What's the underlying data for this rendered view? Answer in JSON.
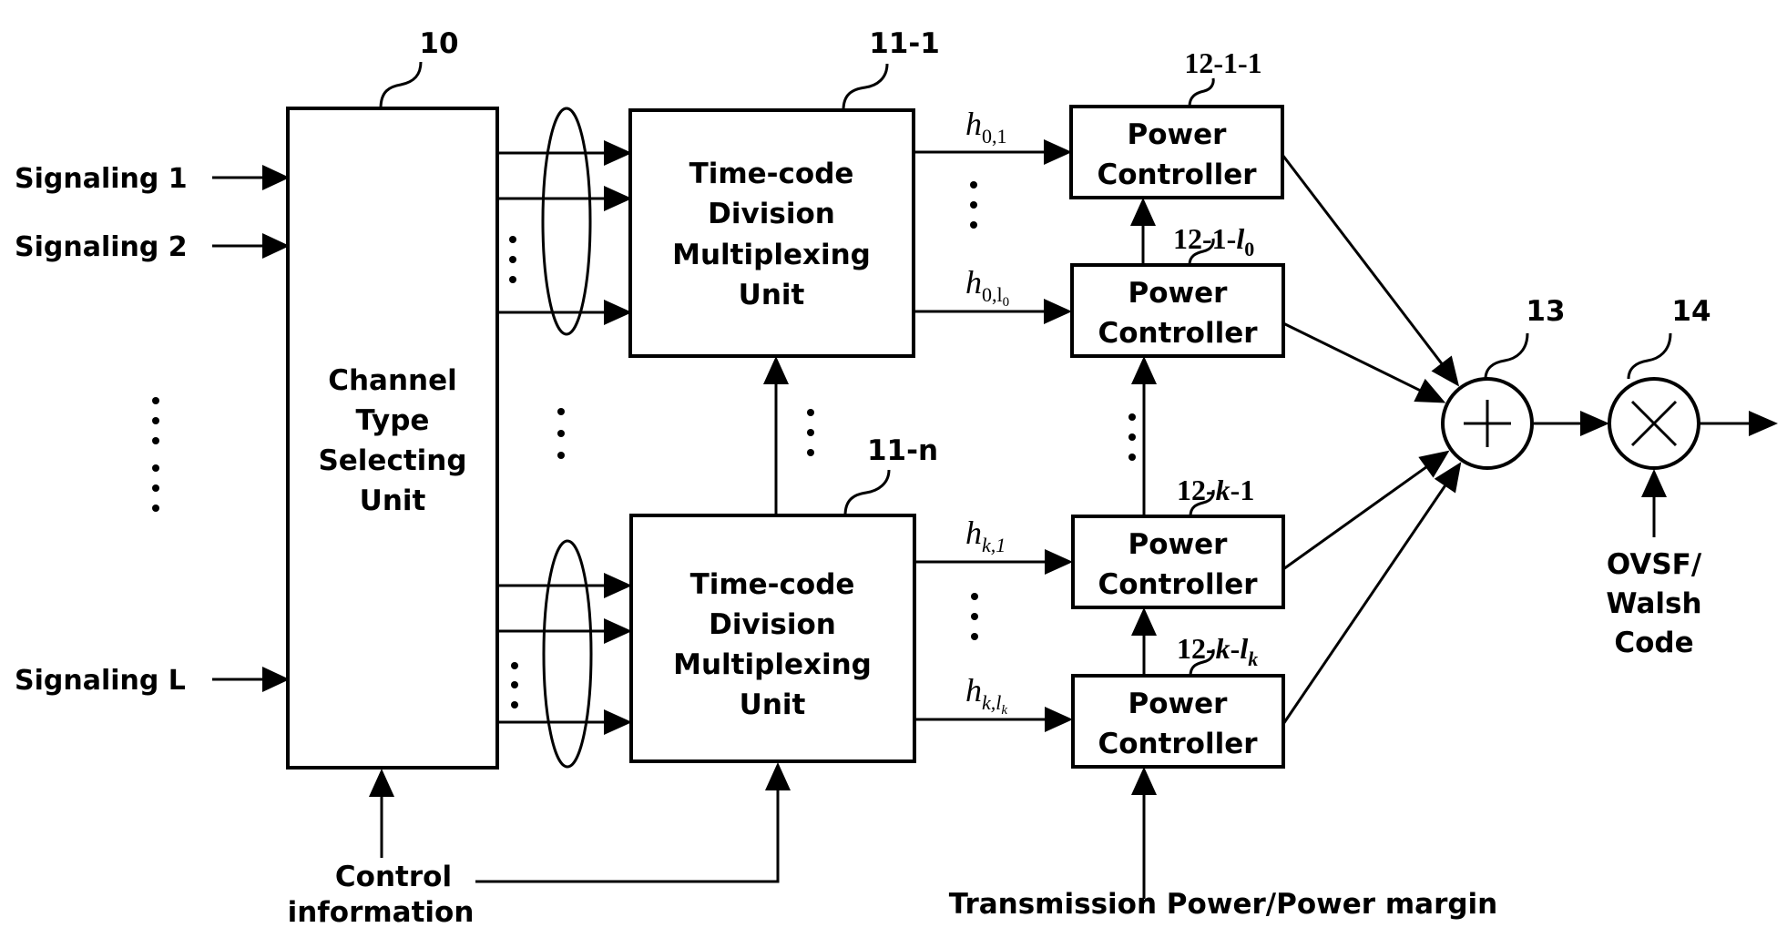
{
  "diagram": {
    "inputs": [
      {
        "label": "Signaling 1"
      },
      {
        "label": "Signaling 2"
      },
      {
        "label": "Signaling L"
      }
    ],
    "channel_unit": {
      "ref": "10",
      "lines": [
        "Channel",
        "Type",
        "Selecting",
        "Unit"
      ]
    },
    "tdm_units": [
      {
        "ref": "11-1",
        "lines": [
          "Time-code",
          "Division",
          "Multiplexing",
          "Unit"
        ],
        "outputs": [
          {
            "base": "h",
            "sub": "0,1"
          },
          {
            "base": "h",
            "sub": "0,l",
            "subsub": "0"
          }
        ]
      },
      {
        "ref": "11-n",
        "lines": [
          "Time-code",
          "Division",
          "Multiplexing",
          "Unit"
        ],
        "outputs": [
          {
            "base": "h",
            "sub": "k,1"
          },
          {
            "base": "h",
            "sub": "k,l",
            "subsub": "k"
          }
        ]
      }
    ],
    "power_controllers": [
      {
        "ref_parts": [
          "12-1-1"
        ],
        "line1": "Power",
        "line2": "Controller"
      },
      {
        "ref_parts": [
          "12-1-",
          "l",
          "0"
        ],
        "line1": "Power",
        "line2": "Controller"
      },
      {
        "ref_parts": [
          "12-",
          "k",
          "-1"
        ],
        "line1": "Power",
        "line2": "Controller"
      },
      {
        "ref_parts": [
          "12-",
          "k",
          "-",
          "l",
          "k"
        ],
        "line1": "Power",
        "line2": "Controller"
      }
    ],
    "adder": {
      "ref": "13",
      "symbol": "plus"
    },
    "multiplier": {
      "ref": "14",
      "symbol": "times"
    },
    "code_input": {
      "lines": [
        "OVSF/",
        "Walsh",
        "Code"
      ]
    },
    "control_input": {
      "lines": [
        "Control",
        "information"
      ]
    },
    "power_input": {
      "label": "Transmission Power/Power margin"
    }
  }
}
